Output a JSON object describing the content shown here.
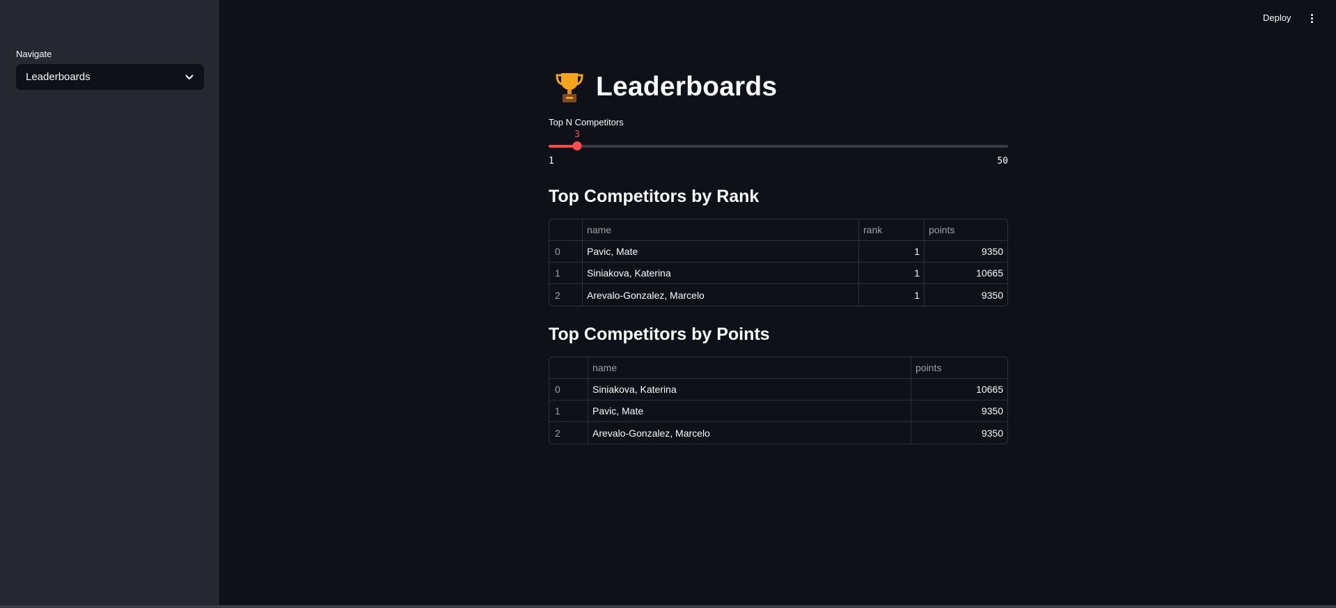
{
  "sidebar": {
    "nav_label": "Navigate",
    "nav_selected": "Leaderboards"
  },
  "header": {
    "deploy_label": "Deploy"
  },
  "main": {
    "title_icon": "trophy-icon",
    "title": "Leaderboards",
    "slider": {
      "label": "Top N Competitors",
      "value": 3,
      "min": 1,
      "max": 50,
      "value_text": "3",
      "min_text": "1",
      "max_text": "50"
    },
    "rank_table": {
      "heading": "Top Competitors by Rank",
      "columns": [
        "",
        "name",
        "rank",
        "points"
      ],
      "rows": [
        {
          "index": "0",
          "name": "Pavic, Mate",
          "rank": "1",
          "points": "9350"
        },
        {
          "index": "1",
          "name": "Siniakova, Katerina",
          "rank": "1",
          "points": "10665"
        },
        {
          "index": "2",
          "name": "Arevalo-Gonzalez, Marcelo",
          "rank": "1",
          "points": "9350"
        }
      ]
    },
    "points_table": {
      "heading": "Top Competitors by Points",
      "columns": [
        "",
        "name",
        "points"
      ],
      "rows": [
        {
          "index": "0",
          "name": "Siniakova, Katerina",
          "points": "10665"
        },
        {
          "index": "1",
          "name": "Pavic, Mate",
          "points": "9350"
        },
        {
          "index": "2",
          "name": "Arevalo-Gonzalez, Marcelo",
          "points": "9350"
        }
      ]
    }
  },
  "colors": {
    "background": "#0e1117",
    "sidebar": "#262730",
    "accent": "#ff4b4b",
    "trophy": "#f4a51c"
  }
}
